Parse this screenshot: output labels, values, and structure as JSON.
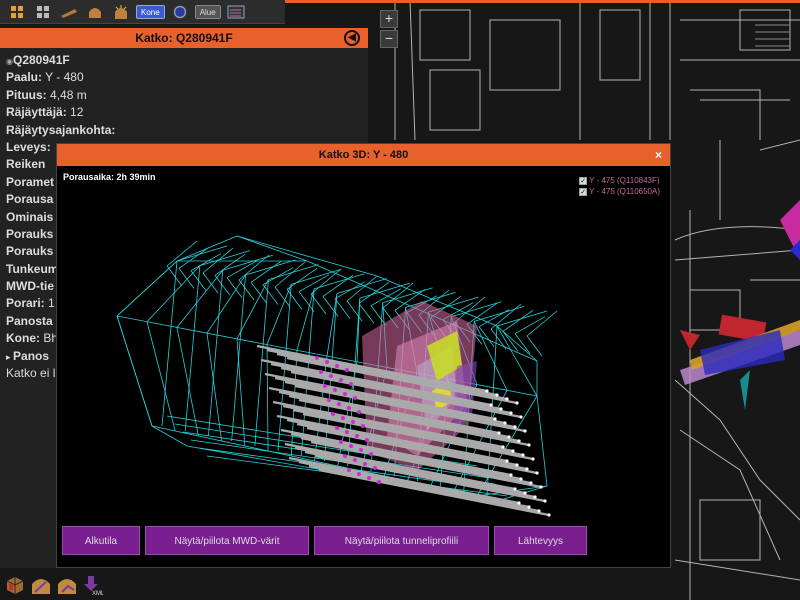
{
  "toolbar": {
    "kone_label": "Kone",
    "alue_label": "Alue"
  },
  "zoom": {
    "plus": "+",
    "minus": "−"
  },
  "panel": {
    "title": "Katko: Q280941F",
    "id": "Q280941F",
    "rows": [
      {
        "key": "Paalu:",
        "value": "Y - 480"
      },
      {
        "key": "Pituus:",
        "value": "4,48 m"
      },
      {
        "key": "Räjäyttäjä:",
        "value": "12"
      },
      {
        "key": "Räjäytysajankohta:",
        "value": ""
      },
      {
        "key": "Leveys:",
        "value": ""
      },
      {
        "key": "Reiken",
        "value": ""
      },
      {
        "key": "Poramet",
        "value": ""
      },
      {
        "key": "Porausa",
        "value": ""
      },
      {
        "key": "Ominais",
        "value": ""
      },
      {
        "key": "Porauks",
        "value": ""
      },
      {
        "key": "Porauks",
        "value": ""
      },
      {
        "key": "Tunkeum",
        "value": ""
      },
      {
        "key": "MWD-tie",
        "value": ""
      },
      {
        "key": "Porari:",
        "value": "1"
      },
      {
        "key": "Panosta",
        "value": ""
      },
      {
        "key": "Kone:",
        "value": "Bh"
      },
      {
        "key": "Panos",
        "value": ""
      }
    ],
    "footer": "Katko ei l"
  },
  "modal": {
    "title": "Katko 3D: Y - 480",
    "close": "×",
    "drill_time": "Porausaika: 2h 39min",
    "legend": [
      {
        "label": "Y - 475 (Q110843F)",
        "checked": "✓"
      },
      {
        "label": "Y - 475 (Q110650A)",
        "checked": "✓"
      }
    ],
    "buttons": [
      "Alkutila",
      "Näytä/piilota MWD-värit",
      "Näytä/piilota tunneliprofiili",
      "Lähtevyys"
    ]
  },
  "colors": {
    "accent": "#e8602c",
    "wire": "#28e0e8",
    "button": "#7a1f8f"
  }
}
